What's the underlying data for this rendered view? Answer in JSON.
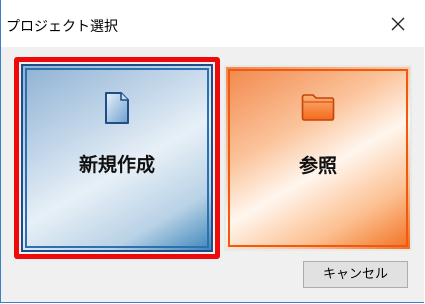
{
  "window": {
    "title": "プロジェクト選択",
    "close_icon": "close-icon"
  },
  "tiles": [
    {
      "label": "新規作成",
      "icon": "document-icon",
      "selected": true,
      "accent": "#2e6fb0"
    },
    {
      "label": "参照",
      "icon": "folder-icon",
      "selected": false,
      "accent": "#f05a10"
    }
  ],
  "buttons": {
    "cancel_label": "キャンセル"
  },
  "colors": {
    "highlight": "#ee0a0a",
    "window_border": "#3a7fc8"
  }
}
